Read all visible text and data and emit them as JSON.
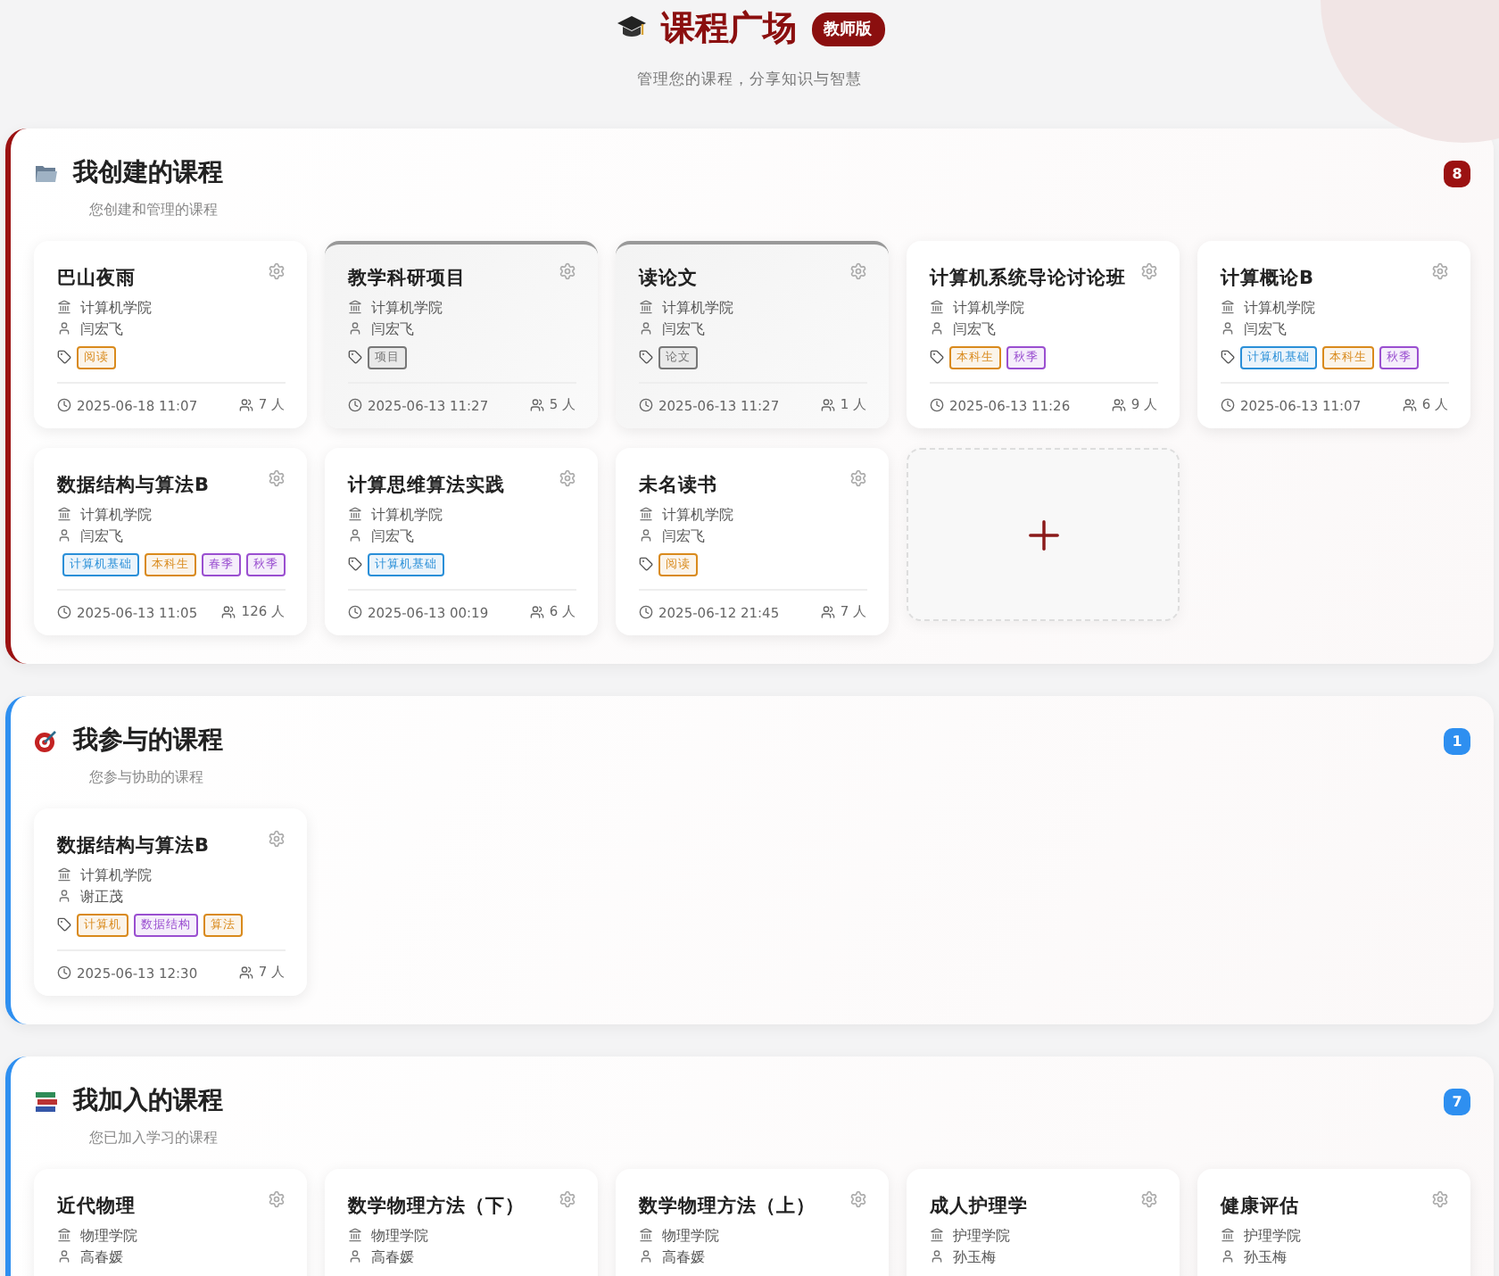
{
  "header": {
    "title": "课程广场",
    "badge": "教师版",
    "subtitle": "管理您的课程，分享知识与智慧"
  },
  "sections": [
    {
      "title": "我创建的课程",
      "subtitle": "您创建和管理的课程",
      "count": "8",
      "color": "#9b1111",
      "courses": [
        {
          "kind": "course",
          "archived": false,
          "title": "巴山夜雨",
          "college": "计算机学院",
          "teacher": "闫宏飞",
          "tags": [
            {
              "label": "阅读",
              "color": "#d98a1c"
            }
          ],
          "time": "2025-06-18 11:07",
          "members": "7 人"
        },
        {
          "kind": "course",
          "archived": true,
          "title": "教学科研项目",
          "college": "计算机学院",
          "teacher": "闫宏飞",
          "tags": [
            {
              "label": "项目",
              "color": "#777777"
            }
          ],
          "time": "2025-06-13 11:27",
          "members": "5 人"
        },
        {
          "kind": "course",
          "archived": true,
          "title": "读论文",
          "college": "计算机学院",
          "teacher": "闫宏飞",
          "tags": [
            {
              "label": "论文",
              "color": "#777777"
            }
          ],
          "time": "2025-06-13 11:27",
          "members": "1 人"
        },
        {
          "kind": "course",
          "archived": false,
          "title": "计算机系统导论讨论班",
          "college": "计算机学院",
          "teacher": "闫宏飞",
          "tags": [
            {
              "label": "本科生",
              "color": "#d98a1c"
            },
            {
              "label": "秋季",
              "color": "#9a4fd0"
            }
          ],
          "time": "2025-06-13 11:26",
          "members": "9 人"
        },
        {
          "kind": "course",
          "archived": false,
          "title": "计算概论B",
          "college": "计算机学院",
          "teacher": "闫宏飞",
          "tags": [
            {
              "label": "计算机基础",
              "color": "#2a8fd8"
            },
            {
              "label": "本科生",
              "color": "#d98a1c"
            },
            {
              "label": "秋季",
              "color": "#9a4fd0"
            }
          ],
          "time": "2025-06-13 11:07",
          "members": "6 人"
        },
        {
          "kind": "course",
          "archived": false,
          "title": "数据结构与算法B",
          "college": "计算机学院",
          "teacher": "闫宏飞",
          "tags": [
            {
              "label": "计算机基础",
              "color": "#2a8fd8"
            },
            {
              "label": "本科生",
              "color": "#d98a1c"
            },
            {
              "label": "春季",
              "color": "#9a4fd0"
            },
            {
              "label": "秋季",
              "color": "#9a4fd0"
            }
          ],
          "time": "2025-06-13 11:05",
          "members": "126 人"
        },
        {
          "kind": "course",
          "archived": false,
          "title": "计算思维算法实践",
          "college": "计算机学院",
          "teacher": "闫宏飞",
          "tags": [
            {
              "label": "计算机基础",
              "color": "#2a8fd8"
            }
          ],
          "time": "2025-06-13 00:19",
          "members": "6 人"
        },
        {
          "kind": "course",
          "archived": false,
          "title": "未名读书",
          "college": "计算机学院",
          "teacher": "闫宏飞",
          "tags": [
            {
              "label": "阅读",
              "color": "#d98a1c"
            }
          ],
          "time": "2025-06-12 21:45",
          "members": "7 人"
        },
        {
          "kind": "add"
        }
      ]
    },
    {
      "title": "我参与的课程",
      "subtitle": "您参与协助的课程",
      "count": "1",
      "color": "#2e8ff0",
      "courses": [
        {
          "kind": "course",
          "archived": false,
          "title": "数据结构与算法B",
          "college": "计算机学院",
          "teacher": "谢正茂",
          "tags": [
            {
              "label": "计算机",
              "color": "#d98a1c"
            },
            {
              "label": "数据结构",
              "color": "#9a4fd0"
            },
            {
              "label": "算法",
              "color": "#d98a1c"
            }
          ],
          "time": "2025-06-13 12:30",
          "members": "7 人"
        }
      ]
    },
    {
      "title": "我加入的课程",
      "subtitle": "您已加入学习的课程",
      "count": "7",
      "color": "#2e8ff0",
      "courses": [
        {
          "kind": "course",
          "archived": false,
          "title": "近代物理",
          "college": "物理学院",
          "teacher": "高春媛"
        },
        {
          "kind": "course",
          "archived": false,
          "title": "数学物理方法（下）",
          "college": "物理学院",
          "teacher": "高春媛"
        },
        {
          "kind": "course",
          "archived": false,
          "title": "数学物理方法（上）",
          "college": "物理学院",
          "teacher": "高春媛"
        },
        {
          "kind": "course",
          "archived": false,
          "title": "成人护理学",
          "college": "护理学院",
          "teacher": "孙玉梅"
        },
        {
          "kind": "course",
          "archived": false,
          "title": "健康评估",
          "college": "护理学院",
          "teacher": "孙玉梅"
        }
      ]
    }
  ]
}
